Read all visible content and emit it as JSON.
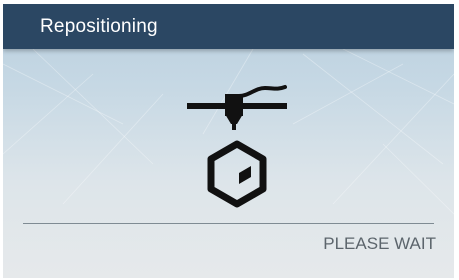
{
  "header": {
    "title": "Repositioning"
  },
  "main": {
    "icons": [
      "printhead-icon",
      "cube-icon"
    ]
  },
  "footer": {
    "status": "PLEASE WAIT"
  },
  "colors": {
    "header_bg": "#2b4763",
    "header_text": "#ffffff",
    "icon": "#111111",
    "status_text": "#5c656c",
    "divider": "#7f8b93"
  }
}
